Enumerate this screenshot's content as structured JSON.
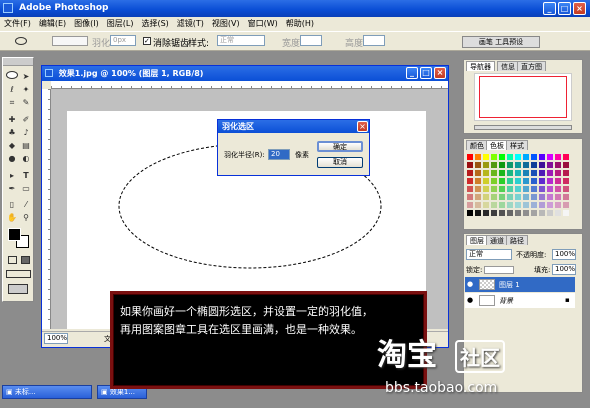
{
  "app": {
    "title": "Adobe Photoshop"
  },
  "menu": [
    "文件(F)",
    "编辑(E)",
    "图像(I)",
    "图层(L)",
    "选择(S)",
    "滤镜(T)",
    "视图(V)",
    "窗口(W)",
    "帮助(H)"
  ],
  "options": {
    "feather_label": "羽化:",
    "feather_value": "0px",
    "antialias_label": "消除锯齿",
    "style_label": "样式:",
    "style_value": "正常",
    "width_label": "宽度:",
    "height_label": "高度:",
    "brush_btn": "画笔 工具预设"
  },
  "document": {
    "title": "效果1.jpg @ 100% (图层 1, RGB/8)",
    "zoom": "100%",
    "status_char": "文"
  },
  "dialog": {
    "title": "羽化选区",
    "label": "羽化半径(R):",
    "value": "20",
    "unit": "像素",
    "ok": "确定",
    "cancel": "取消"
  },
  "navigator": {
    "tabs": [
      "导航器",
      "信息",
      "直方图"
    ]
  },
  "color_panel": {
    "tabs": [
      "颜色",
      "色板",
      "样式"
    ]
  },
  "layers": {
    "tabs": [
      "图层",
      "通道",
      "路径"
    ],
    "blend": "正常",
    "opacity_label": "不透明度:",
    "opacity": "100%",
    "lock_label": "锁定:",
    "fill_label": "填充:",
    "fill": "100%",
    "items": [
      {
        "name": "图层 1"
      },
      {
        "name": "背景"
      }
    ]
  },
  "caption": {
    "line1": "如果你画好一个椭圆形选区，并设置一定的羽化值，",
    "line2": "再用图案图章工具在选区里画满，也是一种效果。"
  },
  "taskbar": {
    "item1": "未标...",
    "item2": "效果1..."
  },
  "watermark": {
    "logo": "淘宝",
    "sub": "社区",
    "url": "bbs.taobao.com"
  }
}
